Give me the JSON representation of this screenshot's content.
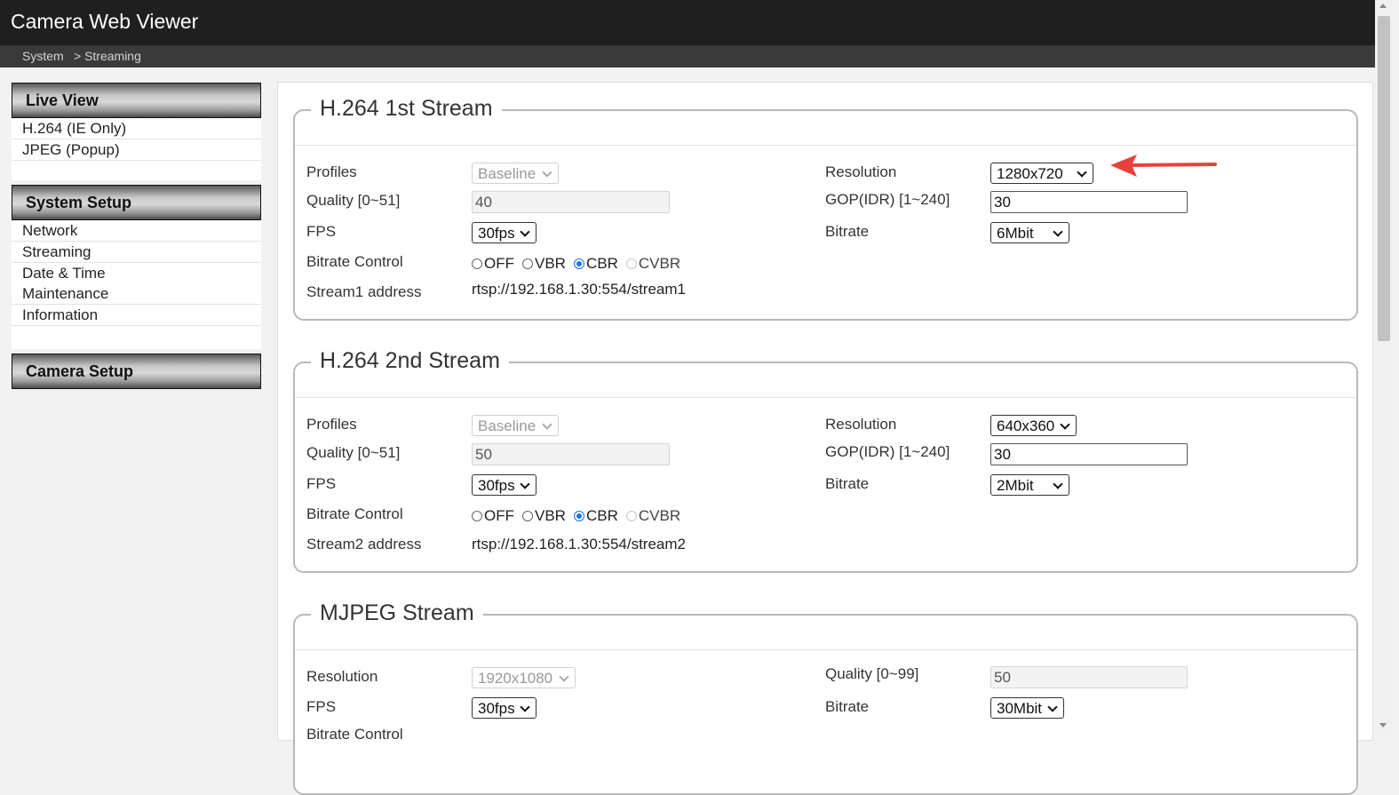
{
  "app": {
    "title": "Camera Web Viewer"
  },
  "breadcrumb": {
    "root": "System",
    "current": "> Streaming"
  },
  "sidebar": {
    "live_view": {
      "header": "Live View",
      "items": [
        "H.264 (IE Only)",
        "JPEG  (Popup)"
      ]
    },
    "system_setup": {
      "header": "System Setup",
      "items": [
        "Network",
        "Streaming",
        "Date & Time",
        "Maintenance",
        "Information"
      ]
    },
    "camera_setup": {
      "header": "Camera Setup"
    }
  },
  "streams": {
    "first": {
      "title": "H.264 1st Stream",
      "profiles_label": "Profiles",
      "profiles_value": "Baseline",
      "quality_label": "Quality [0~51]",
      "quality_value": "40",
      "fps_label": "FPS",
      "fps_value": "30fps",
      "bitrate_control_label": "Bitrate Control",
      "address_label": "Stream1 address",
      "address_value": "rtsp://192.168.1.30:554/stream1",
      "resolution_label": "Resolution",
      "resolution_value": "1280x720",
      "gop_label": "GOP(IDR) [1~240]",
      "gop_value": "30",
      "bitrate_label": "Bitrate",
      "bitrate_value": "6Mbit",
      "radio": {
        "off": "OFF",
        "vbr": "VBR",
        "cbr": "CBR",
        "cvbr": "CVBR"
      }
    },
    "second": {
      "title": "H.264 2nd Stream",
      "profiles_label": "Profiles",
      "profiles_value": "Baseline",
      "quality_label": "Quality [0~51]",
      "quality_value": "50",
      "fps_label": "FPS",
      "fps_value": "30fps",
      "bitrate_control_label": "Bitrate Control",
      "address_label": "Stream2 address",
      "address_value": "rtsp://192.168.1.30:554/stream2",
      "resolution_label": "Resolution",
      "resolution_value": "640x360",
      "gop_label": "GOP(IDR) [1~240]",
      "gop_value": "30",
      "bitrate_label": "Bitrate",
      "bitrate_value": "2Mbit",
      "radio": {
        "off": "OFF",
        "vbr": "VBR",
        "cbr": "CBR",
        "cvbr": "CVBR"
      }
    },
    "mjpeg": {
      "title": "MJPEG Stream",
      "resolution_label": "Resolution",
      "resolution_value": "1920x1080",
      "fps_label": "FPS",
      "fps_value": "30fps",
      "bitrate_control_label": "Bitrate Control",
      "quality_label": "Quality [0~99]",
      "quality_value": "50",
      "bitrate_label": "Bitrate",
      "bitrate_value": "30Mbit"
    }
  },
  "colors": {
    "annotation_arrow": "#e8413c",
    "radio_selected": "#1a73e8",
    "topbar": "#1f1f1f"
  }
}
